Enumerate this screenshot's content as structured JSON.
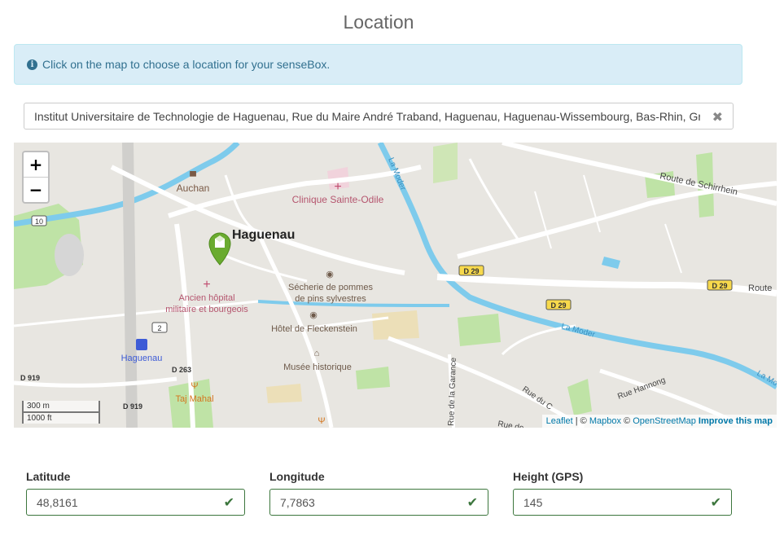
{
  "page": {
    "title": "Location"
  },
  "info": {
    "text": "Click on the map to choose a location for your senseBox.",
    "icon": "info-circle-icon"
  },
  "search": {
    "value": "Institut Universitaire de Technologie de Haguenau, Rue du Maire André Traband, Haguenau, Haguenau-Wissembourg, Bas-Rhin, Grand Est",
    "clear_icon": "close-icon"
  },
  "map": {
    "zoom_in": "+",
    "zoom_out": "−",
    "scale_metric": "300 m",
    "scale_imperial": "1000 ft",
    "attribution": {
      "leaflet": "Leaflet",
      "separator": "|",
      "copy1": "©",
      "mapbox": "Mapbox",
      "copy2": "©",
      "osm": "OpenStreetMap",
      "improve": "Improve this map"
    },
    "labels": {
      "city": "Haguenau",
      "auchan": "Auchan",
      "clinique": "Clinique Sainte-Odile",
      "hopital_1": "Ancien hôpital",
      "hopital_2": "militaire et bourgeois",
      "sechrie_1": "Sécherie de pommes",
      "sechrie_2": "de pins sylvestres",
      "hotel": "Hôtel de Fleckenstein",
      "musee": "Musée historique",
      "station": "Haguenau",
      "taj": "Taj Mahal",
      "la_moder_1": "La Moder",
      "la_moder_2": "La Moder",
      "la_mo": "La Mo",
      "route_schirrhein": "Route de Schirrhein",
      "route": "Route",
      "rue_hannong": "Rue Hannong",
      "rue_garance": "Rue de la Garance",
      "rue_c": "Rue du C",
      "rue_de": "Rue de",
      "r10": "10",
      "r2": "2",
      "d29a": "D 29",
      "d29b": "D 29",
      "d29c": "D 29",
      "d263": "D 263",
      "d919a": "D 919",
      "d919b": "D 919"
    },
    "colors": {
      "water": "#7ecbec",
      "park": "#bfe3a6",
      "road": "#ffffff",
      "marker": "#6aab2f"
    }
  },
  "fields": [
    {
      "label": "Latitude",
      "value": "48,8161"
    },
    {
      "label": "Longitude",
      "value": "7,7863"
    },
    {
      "label": "Height (GPS)",
      "value": "145"
    }
  ]
}
